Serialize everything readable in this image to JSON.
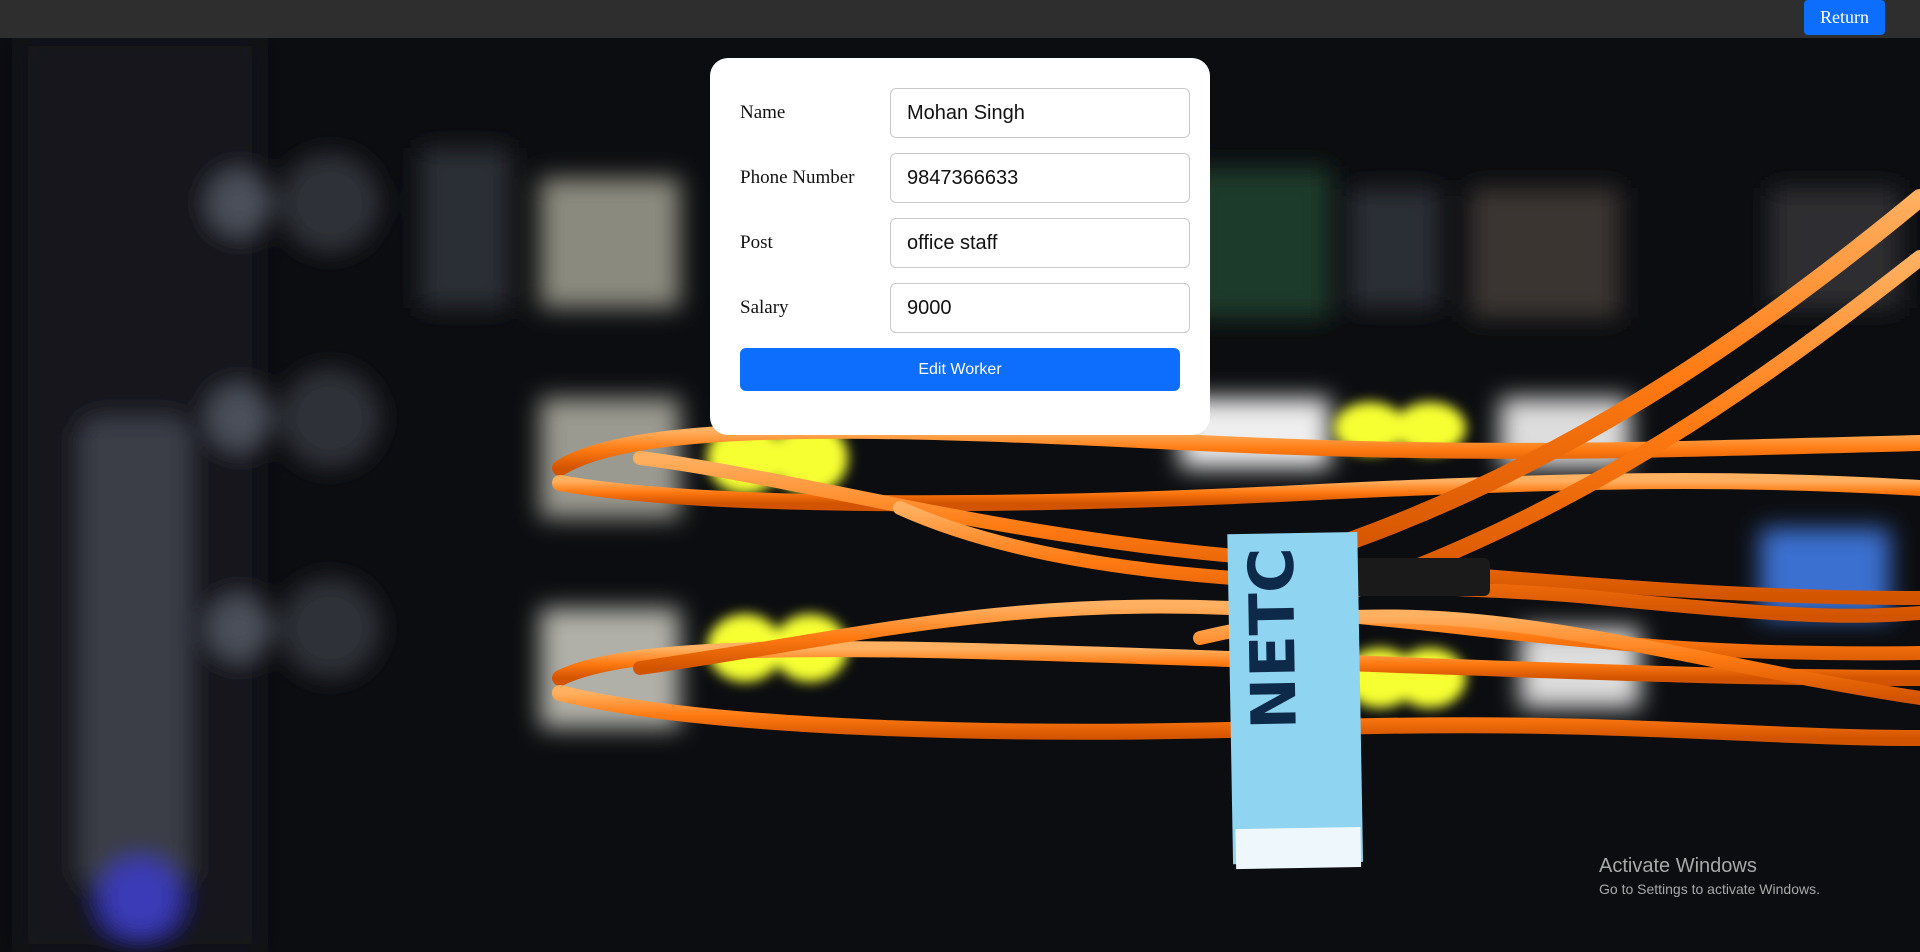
{
  "topbar": {
    "return_label": "Return"
  },
  "form": {
    "fields": [
      {
        "label": "Name",
        "value": "Mohan Singh"
      },
      {
        "label": "Phone Number",
        "value": "9847366633"
      },
      {
        "label": "Post",
        "value": "office staff"
      },
      {
        "label": "Salary",
        "value": "9000"
      }
    ],
    "submit_label": "Edit Worker"
  },
  "watermark": {
    "title": "Activate Windows",
    "subtitle": "Go to Settings to activate Windows."
  },
  "background": {
    "label_text": "NETC"
  },
  "colors": {
    "accent": "#0d6efd",
    "topbar": "#2e2e2e",
    "cable": "#ff7a12"
  }
}
